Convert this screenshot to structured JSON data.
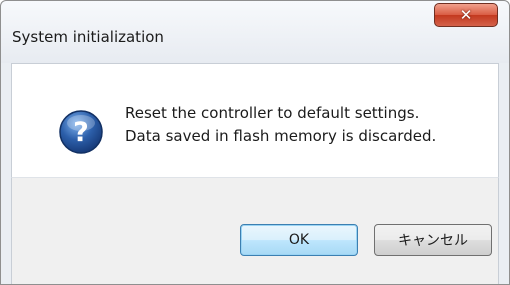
{
  "dialog": {
    "title": "System initialization",
    "close_icon": "close-icon",
    "icon": "question-icon",
    "accent_color": "#2c5faa",
    "close_color": "#c8412a",
    "message_lines": [
      "Reset the controller to default settings.",
      "Data saved in flash memory is discarded."
    ],
    "buttons": {
      "ok_label": "OK",
      "cancel_label": "キャンセル"
    }
  }
}
